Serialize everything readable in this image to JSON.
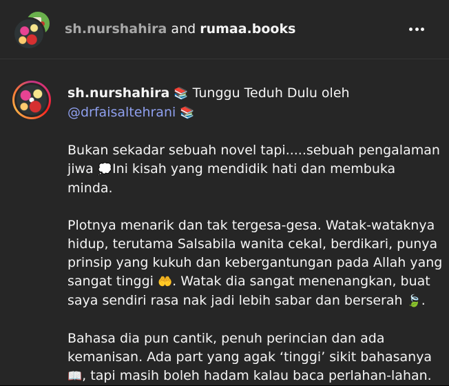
{
  "header": {
    "user1": "sh.nurshahira",
    "conjunction": "and",
    "user2": "rumaa.books",
    "more_icon": "more-horizontal-icon"
  },
  "post": {
    "username": "sh.nurshahira",
    "line1_text": "Tunggu Teduh Dulu oleh",
    "mention": "@drfaisaltehrani",
    "books_emoji": "📚",
    "p1_l1": "Bukan sekadar sebuah novel tapi.....sebuah pengalaman",
    "p1_l2_a": "jiwa",
    "speech_emoji": "💭",
    "p1_l2_b": "Ini kisah yang mendidik hati dan membuka",
    "p1_l3": "minda.",
    "p2_l1": "Plotnya menarik dan tak tergesa-gesa. Watak-wataknya",
    "p2_l2": "hidup, terutama Salsabila wanita cekal, berdikari, punya",
    "p2_l3": "prinsip yang kukuh dan kebergantungan pada Allah yang",
    "p2_l4_a": "sangat tinggi",
    "hands_emoji": "🤲",
    "p2_l4_b": ". Watak dia sangat menenangkan, buat",
    "p2_l5_a": "saya sendiri rasa nak jadi lebih sabar dan berserah",
    "leaf_emoji": "🍃",
    "p2_l5_b": ".",
    "p3_l1": "Bahasa dia pun cantik, penuh perincian dan ada",
    "p3_l2": "kemanisan. Ada part yang agak ‘tinggi’ sikit bahasanya",
    "book_emoji": "📖",
    "p3_l3": ", tapi masih boleh hadam kalau baca perlahan-lahan."
  }
}
